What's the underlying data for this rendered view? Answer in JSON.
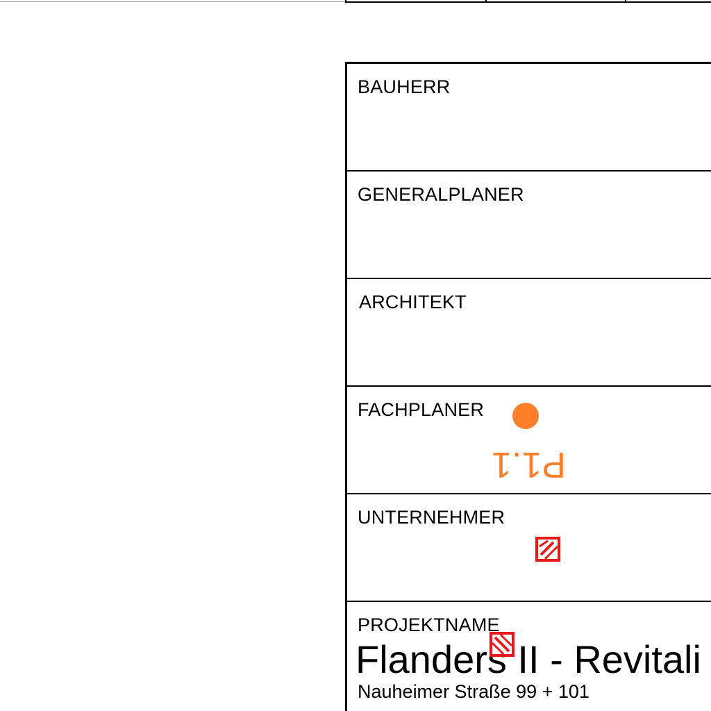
{
  "title_block": {
    "rows": [
      {
        "label": "BAUHERR"
      },
      {
        "label": "GENERALPLANER"
      },
      {
        "label": "ARCHITEKT"
      },
      {
        "label": "FACHPLANER"
      },
      {
        "label": "UNTERNEHMER"
      },
      {
        "label": "PROJEKTNAME"
      }
    ],
    "project_name": "Flanders II - Revitali",
    "project_address": "Nauheimer Straße 99 + 101"
  },
  "markers": {
    "fachplaner_tag": "P1.1",
    "marker_color": "#ff7f2a",
    "hatch_color": "#e8191c"
  }
}
